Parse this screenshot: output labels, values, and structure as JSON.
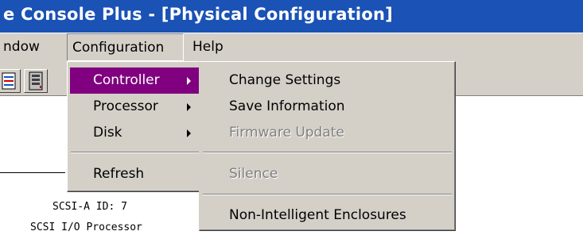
{
  "window": {
    "title": "e Console Plus - [Physical Configuration]"
  },
  "menubar": {
    "items": [
      {
        "label": "ndow"
      },
      {
        "label": "Configuration"
      },
      {
        "label": "Help"
      }
    ]
  },
  "configuration_menu": {
    "items": [
      {
        "label": "Controller",
        "has_submenu": true,
        "highlighted": true
      },
      {
        "label": "Processor",
        "has_submenu": true
      },
      {
        "label": "Disk",
        "has_submenu": true
      },
      {
        "label": "Refresh"
      }
    ]
  },
  "controller_submenu": {
    "items": [
      {
        "label": "Change Settings",
        "enabled": true
      },
      {
        "label": "Save Information",
        "enabled": true
      },
      {
        "label": "Firmware Update",
        "enabled": false
      },
      {
        "label": "Silence",
        "enabled": false
      },
      {
        "label": "Non-Intelligent Enclosures",
        "enabled": true
      }
    ]
  },
  "device_info": {
    "scsi_id": "SCSI-A ID: 7",
    "device_type": "SCSI I/O Processor"
  },
  "colors": {
    "titlebar": "#1a52b5",
    "menu_highlight": "#800080",
    "face": "#d4d0c8"
  }
}
